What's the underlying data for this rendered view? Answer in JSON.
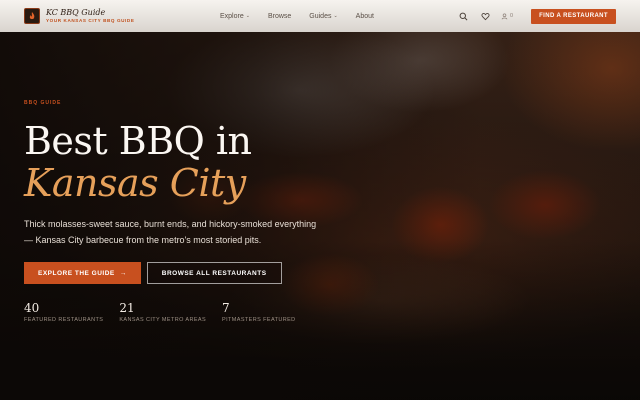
{
  "brand": {
    "name": "KC BBQ Guide",
    "tagline": "YOUR KANSAS CITY BBQ GUIDE",
    "logo_icon": "flame-icon"
  },
  "nav": {
    "items": [
      {
        "label": "Explore",
        "has_dropdown": true
      },
      {
        "label": "Browse",
        "has_dropdown": false
      },
      {
        "label": "Guides",
        "has_dropdown": true
      },
      {
        "label": "About",
        "has_dropdown": false
      }
    ]
  },
  "header_actions": {
    "search_icon": "search-icon",
    "favorites_icon": "heart-icon",
    "account_icon": "user-icon",
    "account_count": "0",
    "cta_label": "FIND A RESTAURANT"
  },
  "hero": {
    "eyebrow": "BBQ GUIDE",
    "title_line1": "Best BBQ in",
    "title_line2": "Kansas City",
    "description": "Thick molasses-sweet sauce, burnt ends, and hickory-smoked everything — Kansas City barbecue from the metro's most storied pits.",
    "primary_label": "EXPLORE THE GUIDE",
    "primary_arrow": "→",
    "secondary_label": "BROWSE ALL RESTAURANTS"
  },
  "stats": [
    {
      "value": "40",
      "label": "FEATURED RESTAURANTS"
    },
    {
      "value": "21",
      "label": "KANSAS CITY METRO AREAS"
    },
    {
      "value": "7",
      "label": "PITMASTERS FEATURED"
    }
  ],
  "colors": {
    "accent": "#c8501f",
    "accent_light": "#e6a05a",
    "header_bg": "#f3f0ec",
    "hero_dark": "#0f0b09"
  }
}
